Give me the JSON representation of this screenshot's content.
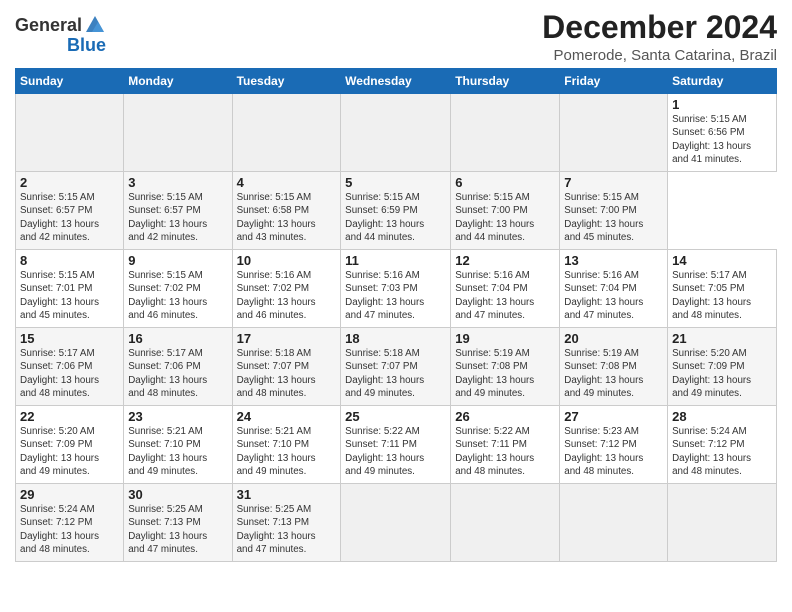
{
  "header": {
    "logo_general": "General",
    "logo_blue": "Blue",
    "title": "December 2024",
    "subtitle": "Pomerode, Santa Catarina, Brazil"
  },
  "calendar": {
    "headers": [
      "Sunday",
      "Monday",
      "Tuesday",
      "Wednesday",
      "Thursday",
      "Friday",
      "Saturday"
    ],
    "weeks": [
      [
        {
          "day": "",
          "info": ""
        },
        {
          "day": "",
          "info": ""
        },
        {
          "day": "",
          "info": ""
        },
        {
          "day": "",
          "info": ""
        },
        {
          "day": "",
          "info": ""
        },
        {
          "day": "",
          "info": ""
        },
        {
          "day": "1",
          "info": "Sunrise: 5:15 AM\nSunset: 6:56 PM\nDaylight: 13 hours\nand 41 minutes."
        }
      ],
      [
        {
          "day": "2",
          "info": "Sunrise: 5:15 AM\nSunset: 6:57 PM\nDaylight: 13 hours\nand 42 minutes."
        },
        {
          "day": "3",
          "info": "Sunrise: 5:15 AM\nSunset: 6:57 PM\nDaylight: 13 hours\nand 42 minutes."
        },
        {
          "day": "4",
          "info": "Sunrise: 5:15 AM\nSunset: 6:58 PM\nDaylight: 13 hours\nand 43 minutes."
        },
        {
          "day": "5",
          "info": "Sunrise: 5:15 AM\nSunset: 6:59 PM\nDaylight: 13 hours\nand 44 minutes."
        },
        {
          "day": "6",
          "info": "Sunrise: 5:15 AM\nSunset: 7:00 PM\nDaylight: 13 hours\nand 44 minutes."
        },
        {
          "day": "7",
          "info": "Sunrise: 5:15 AM\nSunset: 7:00 PM\nDaylight: 13 hours\nand 45 minutes."
        }
      ],
      [
        {
          "day": "8",
          "info": "Sunrise: 5:15 AM\nSunset: 7:01 PM\nDaylight: 13 hours\nand 45 minutes."
        },
        {
          "day": "9",
          "info": "Sunrise: 5:15 AM\nSunset: 7:02 PM\nDaylight: 13 hours\nand 46 minutes."
        },
        {
          "day": "10",
          "info": "Sunrise: 5:16 AM\nSunset: 7:02 PM\nDaylight: 13 hours\nand 46 minutes."
        },
        {
          "day": "11",
          "info": "Sunrise: 5:16 AM\nSunset: 7:03 PM\nDaylight: 13 hours\nand 47 minutes."
        },
        {
          "day": "12",
          "info": "Sunrise: 5:16 AM\nSunset: 7:04 PM\nDaylight: 13 hours\nand 47 minutes."
        },
        {
          "day": "13",
          "info": "Sunrise: 5:16 AM\nSunset: 7:04 PM\nDaylight: 13 hours\nand 47 minutes."
        },
        {
          "day": "14",
          "info": "Sunrise: 5:17 AM\nSunset: 7:05 PM\nDaylight: 13 hours\nand 48 minutes."
        }
      ],
      [
        {
          "day": "15",
          "info": "Sunrise: 5:17 AM\nSunset: 7:06 PM\nDaylight: 13 hours\nand 48 minutes."
        },
        {
          "day": "16",
          "info": "Sunrise: 5:17 AM\nSunset: 7:06 PM\nDaylight: 13 hours\nand 48 minutes."
        },
        {
          "day": "17",
          "info": "Sunrise: 5:18 AM\nSunset: 7:07 PM\nDaylight: 13 hours\nand 48 minutes."
        },
        {
          "day": "18",
          "info": "Sunrise: 5:18 AM\nSunset: 7:07 PM\nDaylight: 13 hours\nand 49 minutes."
        },
        {
          "day": "19",
          "info": "Sunrise: 5:19 AM\nSunset: 7:08 PM\nDaylight: 13 hours\nand 49 minutes."
        },
        {
          "day": "20",
          "info": "Sunrise: 5:19 AM\nSunset: 7:08 PM\nDaylight: 13 hours\nand 49 minutes."
        },
        {
          "day": "21",
          "info": "Sunrise: 5:20 AM\nSunset: 7:09 PM\nDaylight: 13 hours\nand 49 minutes."
        }
      ],
      [
        {
          "day": "22",
          "info": "Sunrise: 5:20 AM\nSunset: 7:09 PM\nDaylight: 13 hours\nand 49 minutes."
        },
        {
          "day": "23",
          "info": "Sunrise: 5:21 AM\nSunset: 7:10 PM\nDaylight: 13 hours\nand 49 minutes."
        },
        {
          "day": "24",
          "info": "Sunrise: 5:21 AM\nSunset: 7:10 PM\nDaylight: 13 hours\nand 49 minutes."
        },
        {
          "day": "25",
          "info": "Sunrise: 5:22 AM\nSunset: 7:11 PM\nDaylight: 13 hours\nand 49 minutes."
        },
        {
          "day": "26",
          "info": "Sunrise: 5:22 AM\nSunset: 7:11 PM\nDaylight: 13 hours\nand 48 minutes."
        },
        {
          "day": "27",
          "info": "Sunrise: 5:23 AM\nSunset: 7:12 PM\nDaylight: 13 hours\nand 48 minutes."
        },
        {
          "day": "28",
          "info": "Sunrise: 5:24 AM\nSunset: 7:12 PM\nDaylight: 13 hours\nand 48 minutes."
        }
      ],
      [
        {
          "day": "29",
          "info": "Sunrise: 5:24 AM\nSunset: 7:12 PM\nDaylight: 13 hours\nand 48 minutes."
        },
        {
          "day": "30",
          "info": "Sunrise: 5:25 AM\nSunset: 7:13 PM\nDaylight: 13 hours\nand 47 minutes."
        },
        {
          "day": "31",
          "info": "Sunrise: 5:25 AM\nSunset: 7:13 PM\nDaylight: 13 hours\nand 47 minutes."
        },
        {
          "day": "",
          "info": ""
        },
        {
          "day": "",
          "info": ""
        },
        {
          "day": "",
          "info": ""
        },
        {
          "day": "",
          "info": ""
        }
      ]
    ]
  }
}
